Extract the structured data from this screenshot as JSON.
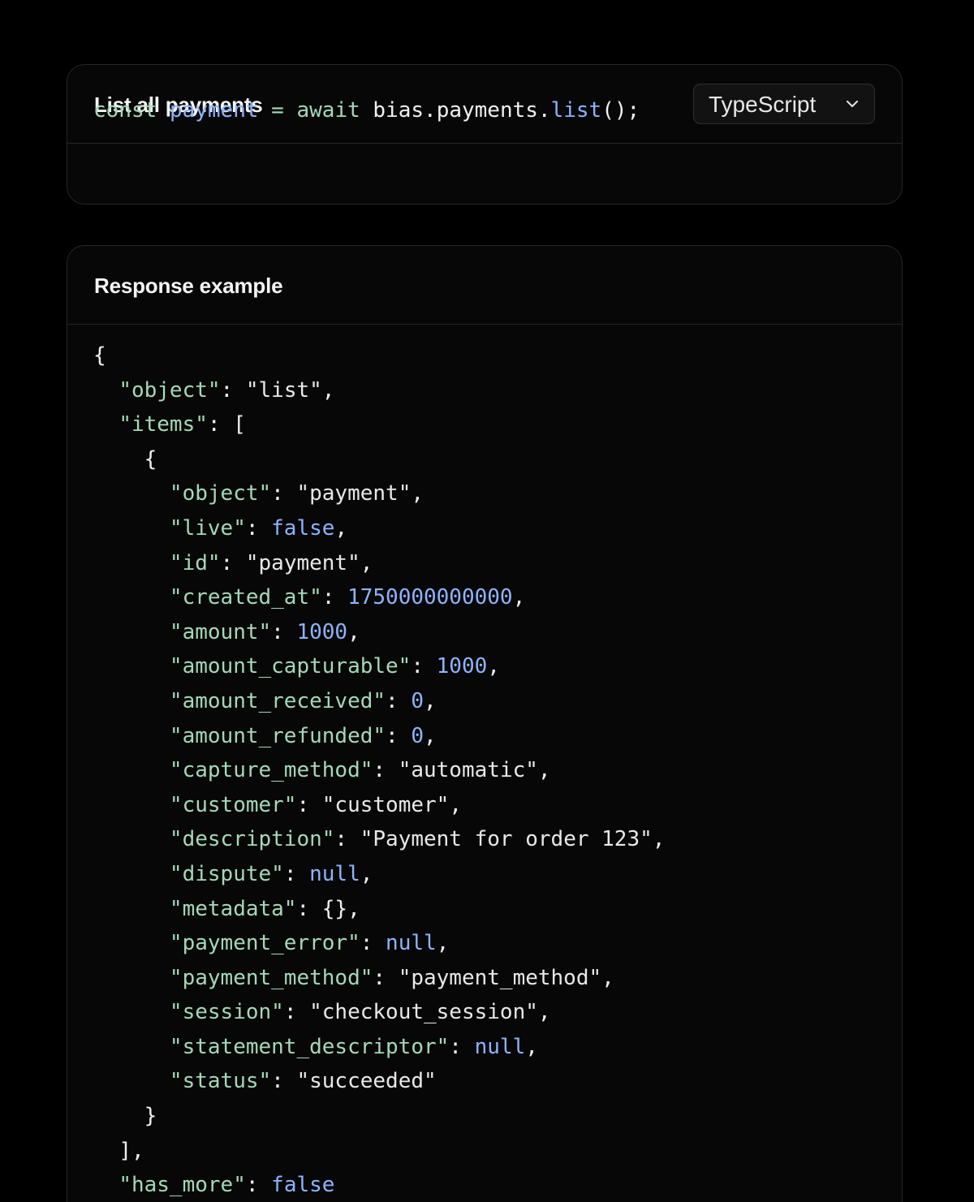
{
  "request": {
    "title": "List all payments",
    "language": "TypeScript",
    "code": {
      "kw_const": "const",
      "var_name": "payment",
      "op_eq": "=",
      "kw_await": "await",
      "object_path": "bias.payments.",
      "method": "list",
      "tail": "();"
    }
  },
  "response": {
    "title": "Response example",
    "json": {
      "open_brace": "{",
      "object_key": "\"object\"",
      "object_value": "\"list\"",
      "items_key": "\"items\"",
      "items_open": "[",
      "item_open": "{",
      "fields": [
        {
          "key": "\"object\"",
          "value": "\"payment\"",
          "type": "str",
          "comma": ","
        },
        {
          "key": "\"live\"",
          "value": "false",
          "type": "lit",
          "comma": ","
        },
        {
          "key": "\"id\"",
          "value": "\"payment\"",
          "type": "str",
          "comma": ","
        },
        {
          "key": "\"created_at\"",
          "value": "1750000000000",
          "type": "num",
          "comma": ","
        },
        {
          "key": "\"amount\"",
          "value": "1000",
          "type": "num",
          "comma": ","
        },
        {
          "key": "\"amount_capturable\"",
          "value": "1000",
          "type": "num",
          "comma": ","
        },
        {
          "key": "\"amount_received\"",
          "value": "0",
          "type": "num",
          "comma": ","
        },
        {
          "key": "\"amount_refunded\"",
          "value": "0",
          "type": "num",
          "comma": ","
        },
        {
          "key": "\"capture_method\"",
          "value": "\"automatic\"",
          "type": "str",
          "comma": ","
        },
        {
          "key": "\"customer\"",
          "value": "\"customer\"",
          "type": "str",
          "comma": ","
        },
        {
          "key": "\"description\"",
          "value": "\"Payment for order 123\"",
          "type": "str",
          "comma": ","
        },
        {
          "key": "\"dispute\"",
          "value": "null",
          "type": "lit",
          "comma": ","
        },
        {
          "key": "\"metadata\"",
          "value": "{}",
          "type": "punct",
          "comma": ","
        },
        {
          "key": "\"payment_error\"",
          "value": "null",
          "type": "lit",
          "comma": ","
        },
        {
          "key": "\"payment_method\"",
          "value": "\"payment_method\"",
          "type": "str",
          "comma": ","
        },
        {
          "key": "\"session\"",
          "value": "\"checkout_session\"",
          "type": "str",
          "comma": ","
        },
        {
          "key": "\"statement_descriptor\"",
          "value": "null",
          "type": "lit",
          "comma": ","
        },
        {
          "key": "\"status\"",
          "value": "\"succeeded\"",
          "type": "str",
          "comma": ""
        }
      ],
      "item_close": "}",
      "items_close": "],",
      "has_more_key": "\"has_more\"",
      "has_more_value": "false"
    }
  },
  "icons": {
    "language_dropdown": "chevron-down-icon"
  },
  "colors": {
    "background": "#000000",
    "card": "#070707",
    "border": "#262626",
    "code_green": "#a3d9b8",
    "code_blue": "#8cb4ff",
    "code_plain": "#f0f0f0"
  }
}
